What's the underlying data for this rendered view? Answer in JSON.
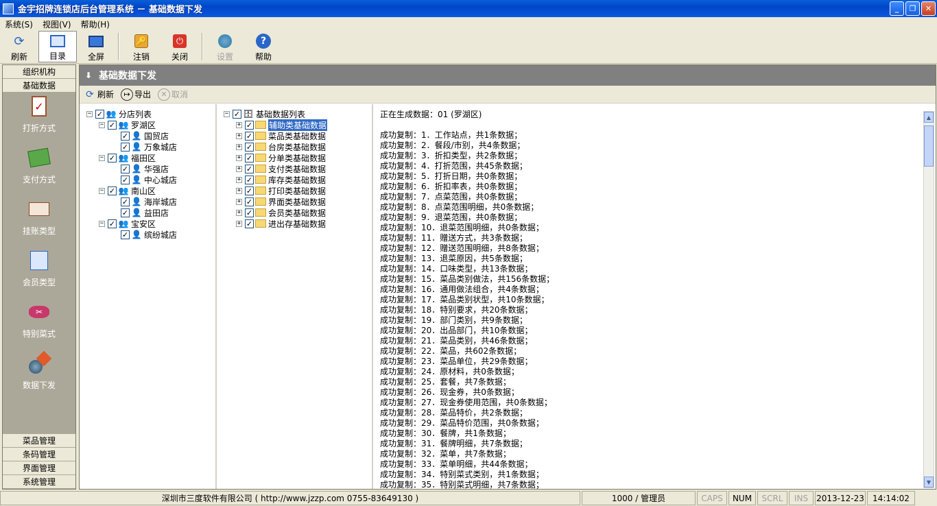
{
  "window": {
    "title": "金宇招牌连锁店后台管理系统  －  基础数据下发"
  },
  "menu": [
    "系统(S)",
    "视图(V)",
    "帮助(H)"
  ],
  "toolbar": [
    {
      "label": "刷新",
      "icon": "refresh-icon"
    },
    {
      "label": "目录",
      "icon": "directory-icon",
      "active": true
    },
    {
      "label": "全屏",
      "icon": "fullscreen-icon"
    },
    {
      "label": "注销",
      "icon": "logout-icon"
    },
    {
      "label": "关闭",
      "icon": "close-icon"
    },
    {
      "label": "设置",
      "icon": "settings-icon",
      "disabled": true
    },
    {
      "label": "帮助",
      "icon": "help-icon"
    }
  ],
  "nav": {
    "top_tabs": [
      "组织机构",
      "基础数据"
    ],
    "items": [
      {
        "label": "打折方式",
        "icon": "clipboard-icon"
      },
      {
        "label": "支付方式",
        "icon": "payment-icon"
      },
      {
        "label": "挂账类型",
        "icon": "card-icon"
      },
      {
        "label": "会员类型",
        "icon": "member-icon"
      },
      {
        "label": "特别菜式",
        "icon": "special-dish-icon"
      },
      {
        "label": "数据下发",
        "icon": "data-send-icon"
      }
    ],
    "bottom_tabs": [
      "菜品管理",
      "条码管理",
      "界面管理",
      "系统管理"
    ]
  },
  "main": {
    "title": "基础数据下发",
    "actions": [
      {
        "label": "刷新",
        "icon": "refresh-icon"
      },
      {
        "label": "导出",
        "icon": "export-icon"
      },
      {
        "label": "取消",
        "icon": "cancel-icon",
        "disabled": true
      }
    ]
  },
  "store_tree": {
    "root": "分店列表",
    "districts": [
      {
        "name": "罗湖区",
        "stores": [
          "国贸店",
          "万象城店"
        ]
      },
      {
        "name": "福田区",
        "stores": [
          "华强店",
          "中心城店"
        ]
      },
      {
        "name": "南山区",
        "stores": [
          "海岸城店",
          "益田店"
        ]
      },
      {
        "name": "宝安区",
        "stores": [
          "缤纷城店"
        ]
      }
    ]
  },
  "data_tree": {
    "root": "基础数据列表",
    "items": [
      "辅助类基础数据",
      "菜品类基础数据",
      "台房类基础数据",
      "分单类基础数据",
      "支付类基础数据",
      "库存类基础数据",
      "打印类基础数据",
      "界面类基础数据",
      "会员类基础数据",
      "进出存基础数据"
    ]
  },
  "log": [
    "正在生成数据：01 (罗湖区)",
    "",
    "成功复制：1．工作站点，共1条数据；",
    "成功复制：2．餐段/市别，共4条数据；",
    "成功复制：3．折扣类型，共2条数据；",
    "成功复制：4．打折范围，共45条数据；",
    "成功复制：5．打折日期，共0条数据；",
    "成功复制：6．折扣率表，共0条数据；",
    "成功复制：7．点菜范围，共0条数据；",
    "成功复制：8．点菜范围明细，共0条数据；",
    "成功复制：9．退菜范围，共0条数据；",
    "成功复制：10．退菜范围明细，共0条数据；",
    "成功复制：11．赠送方式，共3条数据；",
    "成功复制：12．赠送范围明细，共8条数据；",
    "成功复制：13．退菜原因，共5条数据；",
    "成功复制：14．口味类型，共13条数据；",
    "成功复制：15．菜品类别做法，共156条数据；",
    "成功复制：16．通用做法组合，共4条数据；",
    "成功复制：17．菜品类别状型，共10条数据；",
    "成功复制：18．特别要求，共20条数据；",
    "成功复制：19．部门类别，共9条数据；",
    "成功复制：20．出品部门，共10条数据；",
    "成功复制：21．菜品类别，共46条数据；",
    "成功复制：22．菜品，共602条数据；",
    "成功复制：23．菜品单位，共29条数据；",
    "成功复制：24．原材料，共0条数据；",
    "成功复制：25．套餐，共7条数据；",
    "成功复制：26．现金券，共0条数据；",
    "成功复制：27．现金券使用范围，共0条数据；",
    "成功复制：28．菜品特价，共2条数据；",
    "成功复制：29．菜品特价范围，共0条数据；",
    "成功复制：30．餐牌，共1条数据；",
    "成功复制：31．餐牌明细，共7条数据；",
    "成功复制：32．菜单，共7条数据；",
    "成功复制：33．菜单明细，共44条数据；",
    "成功复制：34．特别菜式类别，共1条数据；",
    "成功复制：35．特别菜式明细，共7条数据；"
  ],
  "status": {
    "company": "深圳市三度软件有限公司 ( http://www.jzzp.com  0755-83649130 )",
    "user": "1000 / 管理员",
    "caps": "CAPS",
    "num": "NUM",
    "scrl": "SCRL",
    "ins": "INS",
    "date": "2013-12-23",
    "time": "14:14:02"
  }
}
